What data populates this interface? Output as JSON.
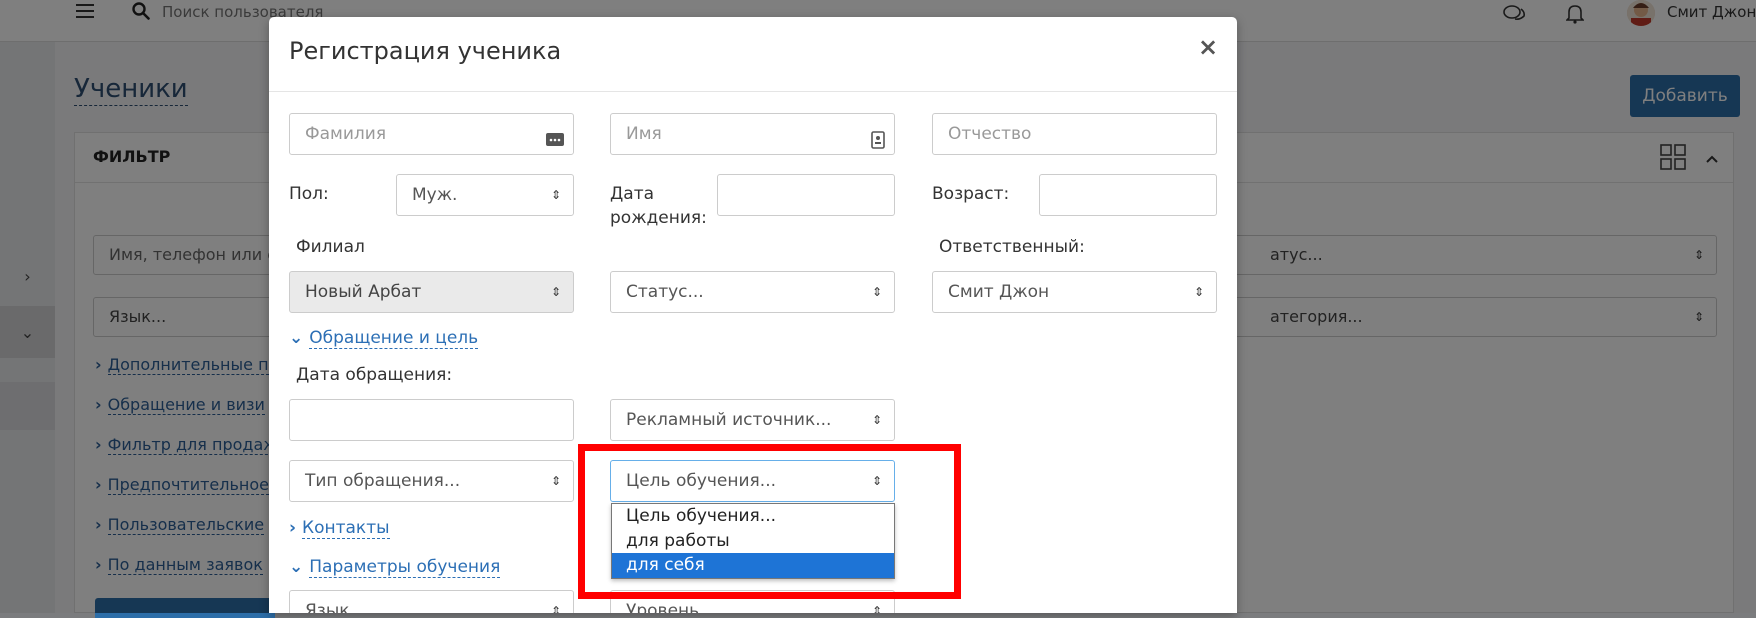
{
  "topbar": {
    "search_placeholder": "Поиск пользователя",
    "user_name": "Смит Джон",
    "user_caret": "▾"
  },
  "page": {
    "title": "Ученики",
    "add_button": "Добавить"
  },
  "filter": {
    "title": "ФИЛЬТР",
    "search_placeholder": "Имя, телефон или е",
    "language": "Язык...",
    "status_partial": "атус...",
    "category_partial": "атегория...",
    "links": [
      "Дополнительные п",
      "Обращение и визи",
      "Фильтр для продаж",
      "Предпочтительное",
      "Пользовательские",
      "По данным заявок"
    ]
  },
  "modal": {
    "title": "Регистрация ученика",
    "close": "×",
    "last_name_placeholder": "Фамилия",
    "first_name_placeholder": "Имя",
    "middle_name_placeholder": "Отчество",
    "gender_label": "Пол:",
    "gender_value": "Муж.",
    "birth_label": "Дата рождения:",
    "age_label": "Возраст:",
    "branch_label": "Филиал",
    "branch_value": "Новый Арбат",
    "status_value": "Статус...",
    "responsible_label": "Ответственный:",
    "responsible_value": "Смит Джон",
    "section_appeal": "Обращение и цель",
    "appeal_date_label": "Дата обращения:",
    "ad_source": "Рекламный источник...",
    "appeal_type": "Тип обращения...",
    "goal": "Цель обучения...",
    "section_contacts": "Контакты",
    "section_params": "Параметры обучения",
    "language_partial": "Язык",
    "level_partial": "Уровень"
  },
  "dropdown": {
    "options": [
      "Цель обучения...",
      "для работы",
      "для себя"
    ],
    "selected_index": 2
  },
  "colors": {
    "highlight": "#ff0000",
    "accent": "#2d6ea8",
    "selected_option": "#1e74d6"
  }
}
